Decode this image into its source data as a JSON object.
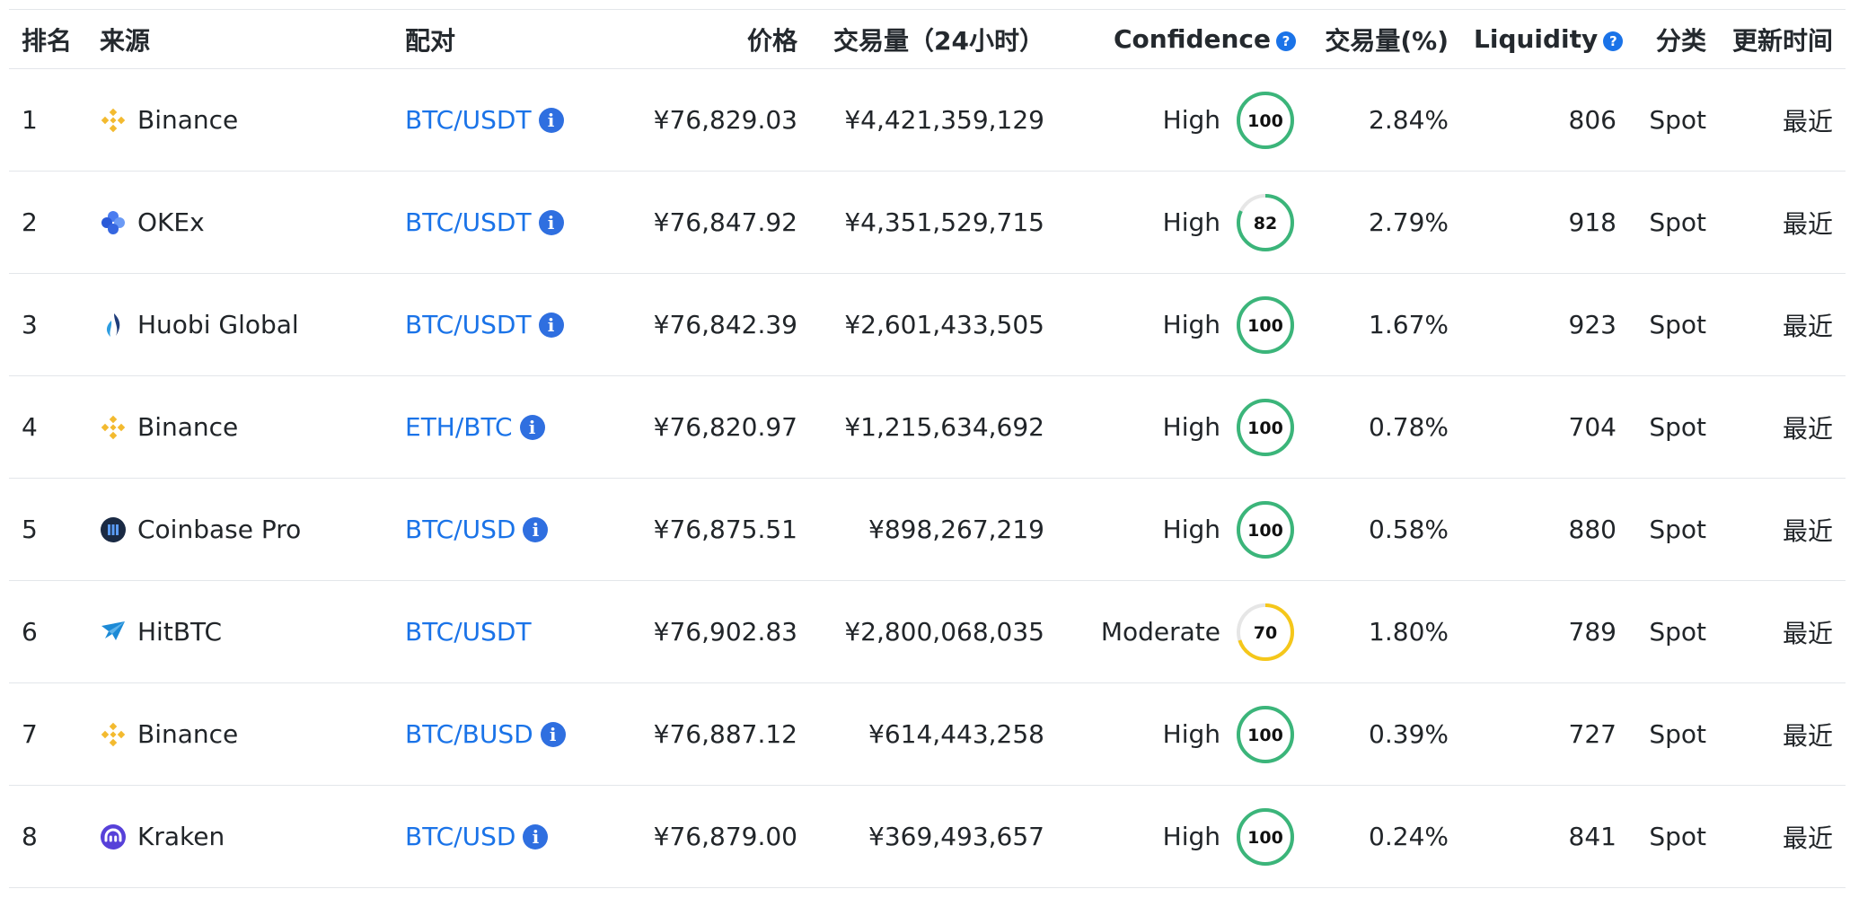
{
  "colors": {
    "link": "#1a73e8",
    "high": "#3bb57a",
    "moderate": "#f5c71a",
    "ring_track": "#e6e6e6"
  },
  "headers": {
    "rank": "排名",
    "source": "来源",
    "pair": "配对",
    "price": "价格",
    "volume": "交易量（24小时）",
    "confidence": "Confidence",
    "volume_pct": "交易量(%)",
    "liquidity": "Liquidity",
    "category": "分类",
    "updated": "更新时间"
  },
  "rows": [
    {
      "rank": "1",
      "exchange": "Binance",
      "logo": "binance-icon",
      "pair": "BTC/USDT",
      "has_info": true,
      "price": "¥76,829.03",
      "volume": "¥4,421,359,129",
      "confidence": "High",
      "score": 100,
      "volume_pct": "2.84%",
      "liquidity": "806",
      "category": "Spot",
      "updated": "最近"
    },
    {
      "rank": "2",
      "exchange": "OKEx",
      "logo": "okex-icon",
      "pair": "BTC/USDT",
      "has_info": true,
      "price": "¥76,847.92",
      "volume": "¥4,351,529,715",
      "confidence": "High",
      "score": 82,
      "volume_pct": "2.79%",
      "liquidity": "918",
      "category": "Spot",
      "updated": "最近"
    },
    {
      "rank": "3",
      "exchange": "Huobi Global",
      "logo": "huobi-icon",
      "pair": "BTC/USDT",
      "has_info": true,
      "price": "¥76,842.39",
      "volume": "¥2,601,433,505",
      "confidence": "High",
      "score": 100,
      "volume_pct": "1.67%",
      "liquidity": "923",
      "category": "Spot",
      "updated": "最近"
    },
    {
      "rank": "4",
      "exchange": "Binance",
      "logo": "binance-icon",
      "pair": "ETH/BTC",
      "has_info": true,
      "price": "¥76,820.97",
      "volume": "¥1,215,634,692",
      "confidence": "High",
      "score": 100,
      "volume_pct": "0.78%",
      "liquidity": "704",
      "category": "Spot",
      "updated": "最近"
    },
    {
      "rank": "5",
      "exchange": "Coinbase Pro",
      "logo": "coinbase-pro-icon",
      "pair": "BTC/USD",
      "has_info": true,
      "price": "¥76,875.51",
      "volume": "¥898,267,219",
      "confidence": "High",
      "score": 100,
      "volume_pct": "0.58%",
      "liquidity": "880",
      "category": "Spot",
      "updated": "最近"
    },
    {
      "rank": "6",
      "exchange": "HitBTC",
      "logo": "hitbtc-icon",
      "pair": "BTC/USDT",
      "has_info": false,
      "price": "¥76,902.83",
      "volume": "¥2,800,068,035",
      "confidence": "Moderate",
      "score": 70,
      "volume_pct": "1.80%",
      "liquidity": "789",
      "category": "Spot",
      "updated": "最近"
    },
    {
      "rank": "7",
      "exchange": "Binance",
      "logo": "binance-icon",
      "pair": "BTC/BUSD",
      "has_info": true,
      "price": "¥76,887.12",
      "volume": "¥614,443,258",
      "confidence": "High",
      "score": 100,
      "volume_pct": "0.39%",
      "liquidity": "727",
      "category": "Spot",
      "updated": "最近"
    },
    {
      "rank": "8",
      "exchange": "Kraken",
      "logo": "kraken-icon",
      "pair": "BTC/USD",
      "has_info": true,
      "price": "¥76,879.00",
      "volume": "¥369,493,657",
      "confidence": "High",
      "score": 100,
      "volume_pct": "0.24%",
      "liquidity": "841",
      "category": "Spot",
      "updated": "最近"
    }
  ]
}
